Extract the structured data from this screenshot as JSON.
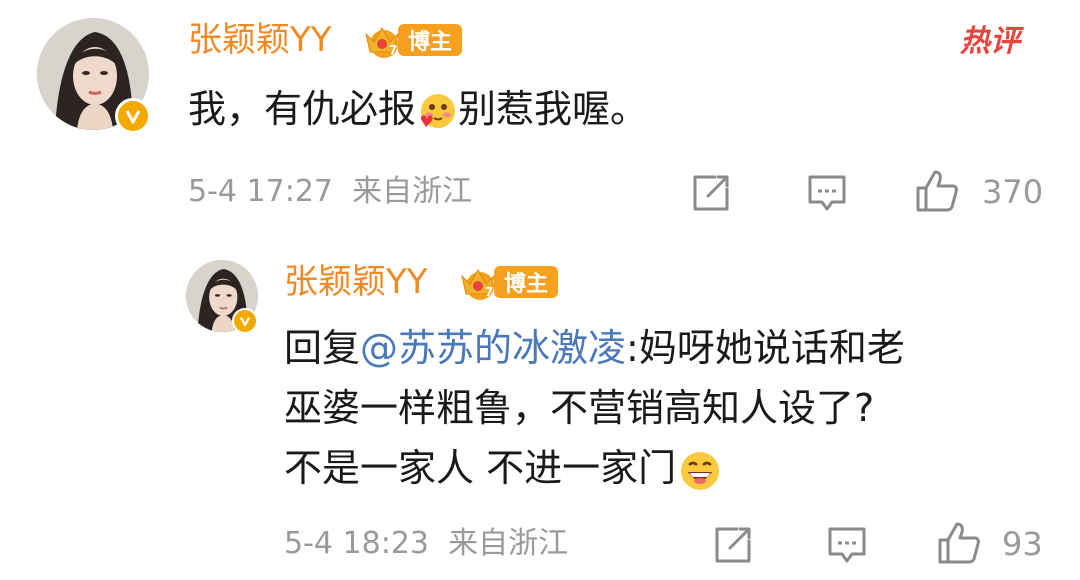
{
  "hot_label": "热评",
  "comment": {
    "username": "张颖颖YY",
    "badge": "博主",
    "text_before_emoji": "我，有仇必报",
    "text_after_emoji": "别惹我喔。",
    "emoji": "blushing-heart-emoji",
    "time": "5-4 17:27",
    "location": "来自浙江",
    "likes": "370"
  },
  "reply": {
    "username": "张颖颖YY",
    "badge": "博主",
    "reply_prefix": "回复",
    "mention": "@苏苏的冰激凌",
    "line1_rest": ":妈呀她说话和老",
    "line2": "巫婆一样粗鲁，不营销高知人设了?",
    "line3": "不是一家人 不进一家门",
    "emoji": "laughing-emoji",
    "time": "5-4 18:23",
    "location": "来自浙江",
    "likes": "93"
  },
  "colors": {
    "username": "#f08a24",
    "mention": "#4a78b8",
    "meta": "#9a9a9a",
    "hot": "#e8433c",
    "badge": "#f7a01e"
  },
  "icons": {
    "share": "share-icon",
    "comment": "comment-icon",
    "like": "like-icon",
    "verified": "verified-icon",
    "crown": "crown-icon"
  }
}
